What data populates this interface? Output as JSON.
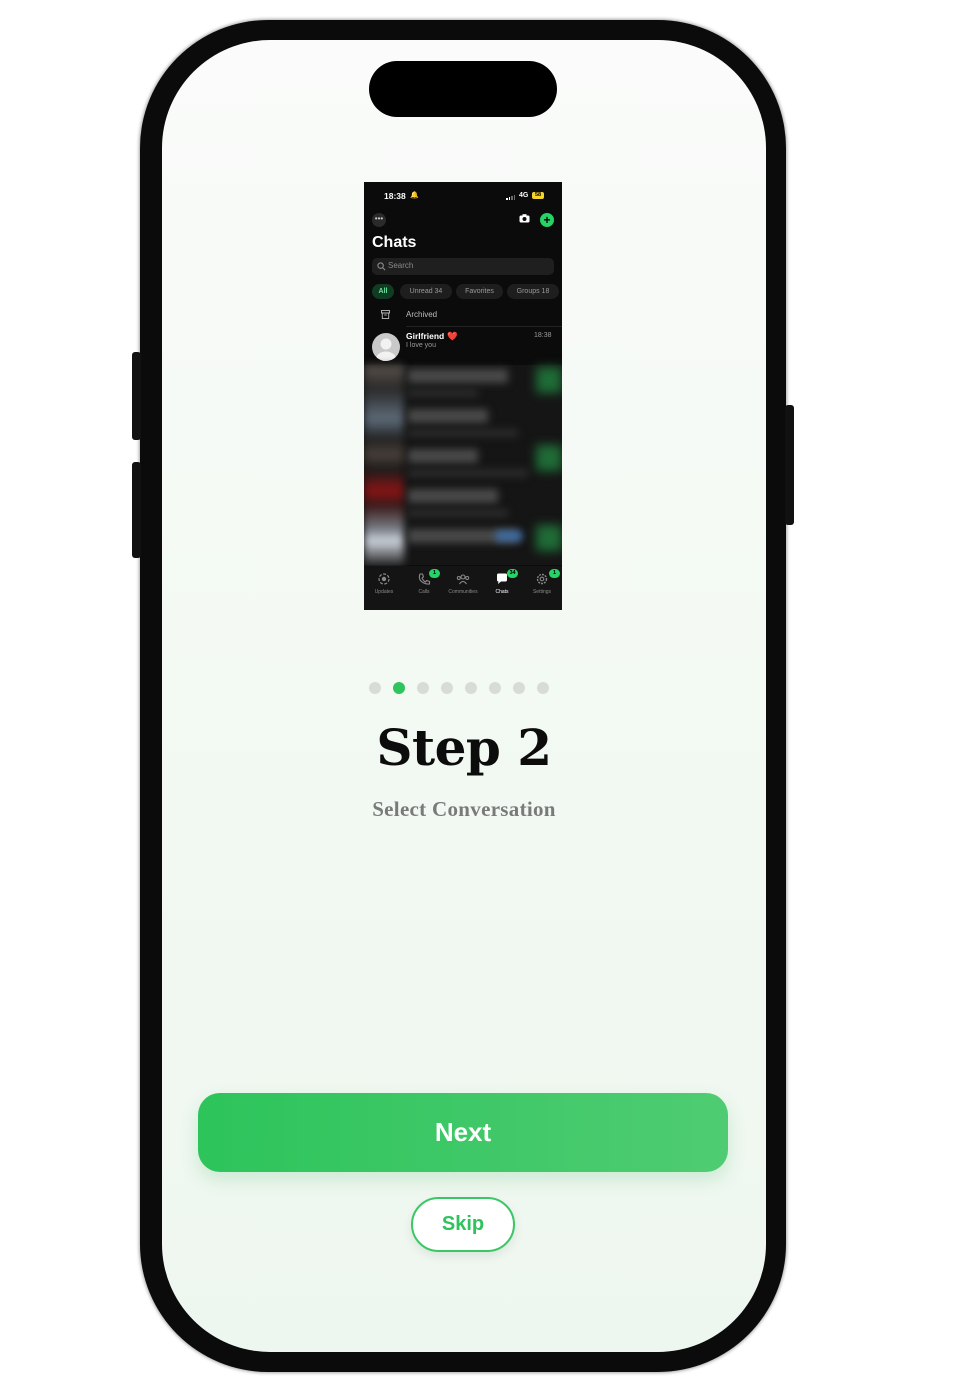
{
  "device": {
    "model": "phone",
    "frame_color": "#0b0b0b"
  },
  "tutorial_image": {
    "status_bar": {
      "time": "18:38",
      "network": "4G",
      "battery": "58"
    },
    "title": "Chats",
    "search_placeholder": "Search",
    "filters": [
      "All",
      "Unread 34",
      "Favorites",
      "Groups 18"
    ],
    "archived_label": "Archived",
    "chat": {
      "name": "Girlfriend",
      "emoji": "❤️",
      "time": "18:38",
      "message": "I love you"
    },
    "tabs": [
      {
        "label": "Updates",
        "badge": ""
      },
      {
        "label": "Calls",
        "badge": "1"
      },
      {
        "label": "Communities",
        "badge": ""
      },
      {
        "label": "Chats",
        "badge": "34"
      },
      {
        "label": "Settings",
        "badge": "1"
      }
    ]
  },
  "pagination": {
    "total": 8,
    "current": 2
  },
  "step": {
    "title": "Step 2",
    "subtitle": "Select Conversation"
  },
  "buttons": {
    "next_label": "Next",
    "skip_label": "Skip"
  },
  "colors": {
    "accent": "#2fc45c",
    "dot_inactive": "#d9dbd9",
    "subtitle": "#7a7a7a"
  }
}
